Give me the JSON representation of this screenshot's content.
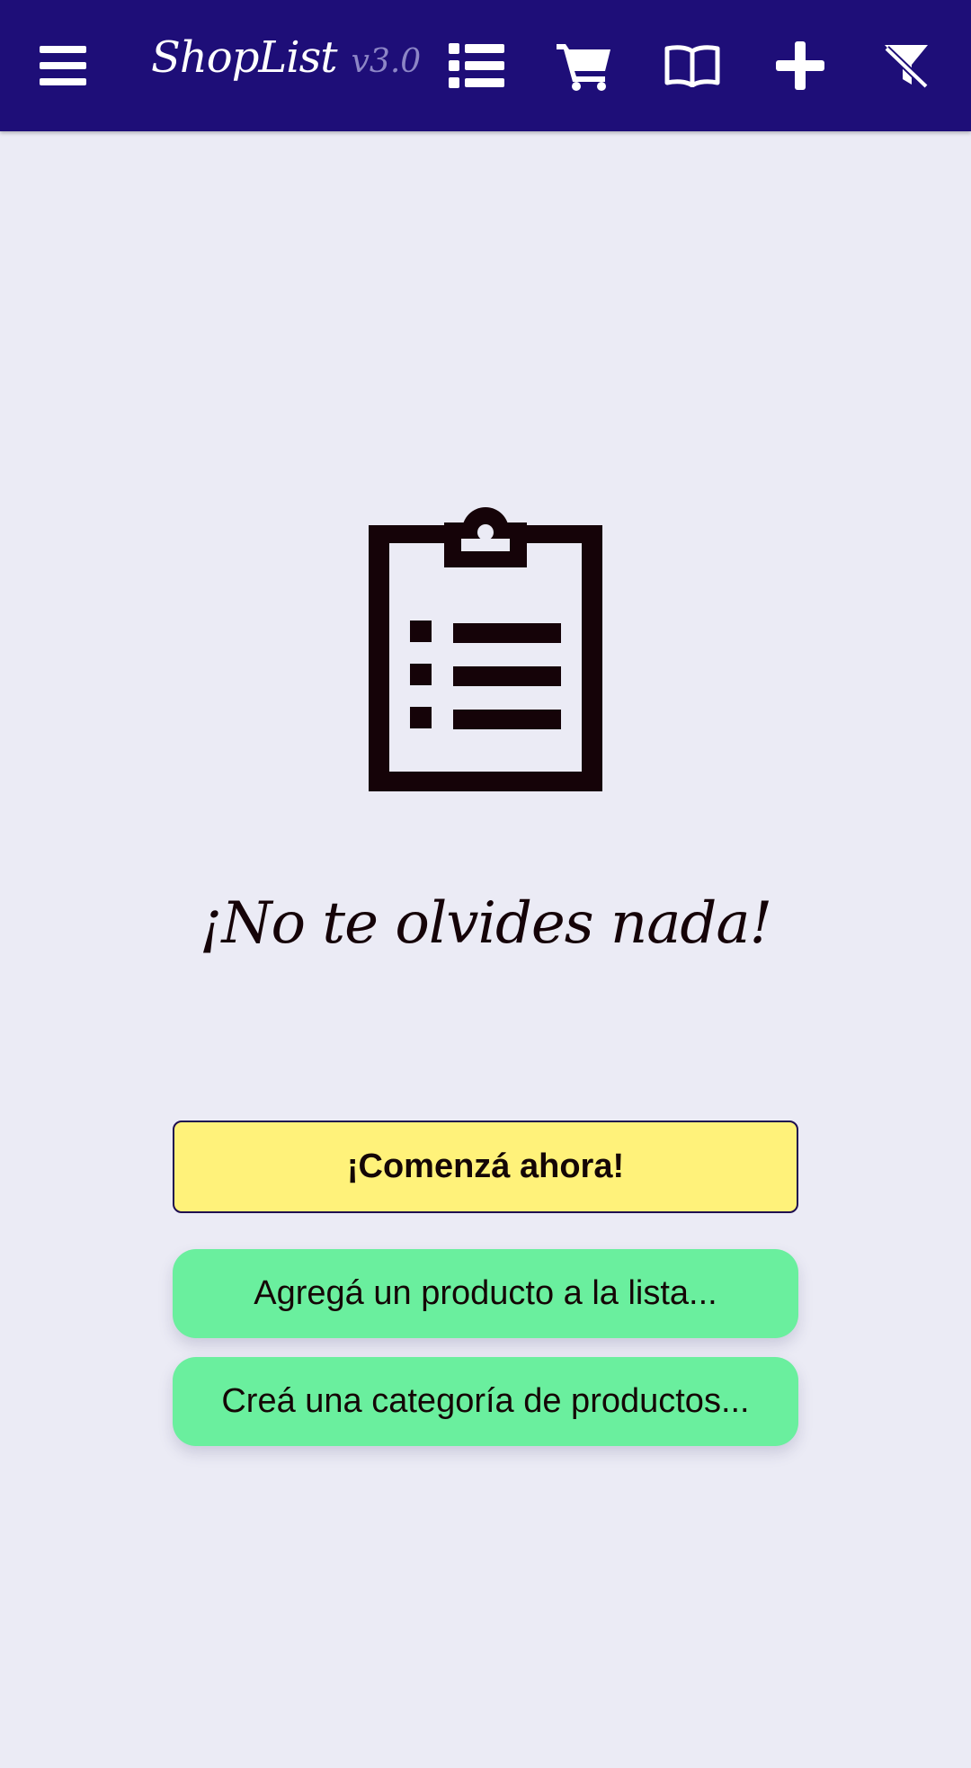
{
  "app": {
    "name": "ShopList",
    "version": "v3.0"
  },
  "toolbar": {
    "items": [
      {
        "name": "menu",
        "icon": "hamburger-menu-icon"
      },
      {
        "name": "list",
        "icon": "list-icon"
      },
      {
        "name": "cart",
        "icon": "shopping-cart-icon"
      },
      {
        "name": "catalog",
        "icon": "open-book-icon"
      },
      {
        "name": "add",
        "icon": "plus-icon"
      },
      {
        "name": "clear-filter",
        "icon": "filter-off-icon"
      }
    ]
  },
  "empty_state": {
    "icon": "clipboard-list-icon",
    "tagline": "¡No te olvides nada!",
    "primary_button": "¡Comenzá ahora!",
    "add_product_button": "Agregá un producto a la lista...",
    "create_category_button": "Creá una categoría de productos..."
  },
  "colors": {
    "topbar": "#1e0e78",
    "background": "#ebebf5",
    "primary_button": "#fff27a",
    "secondary_button": "#6aef9e",
    "text_dark": "#150308",
    "version_text": "#8d86c6"
  }
}
